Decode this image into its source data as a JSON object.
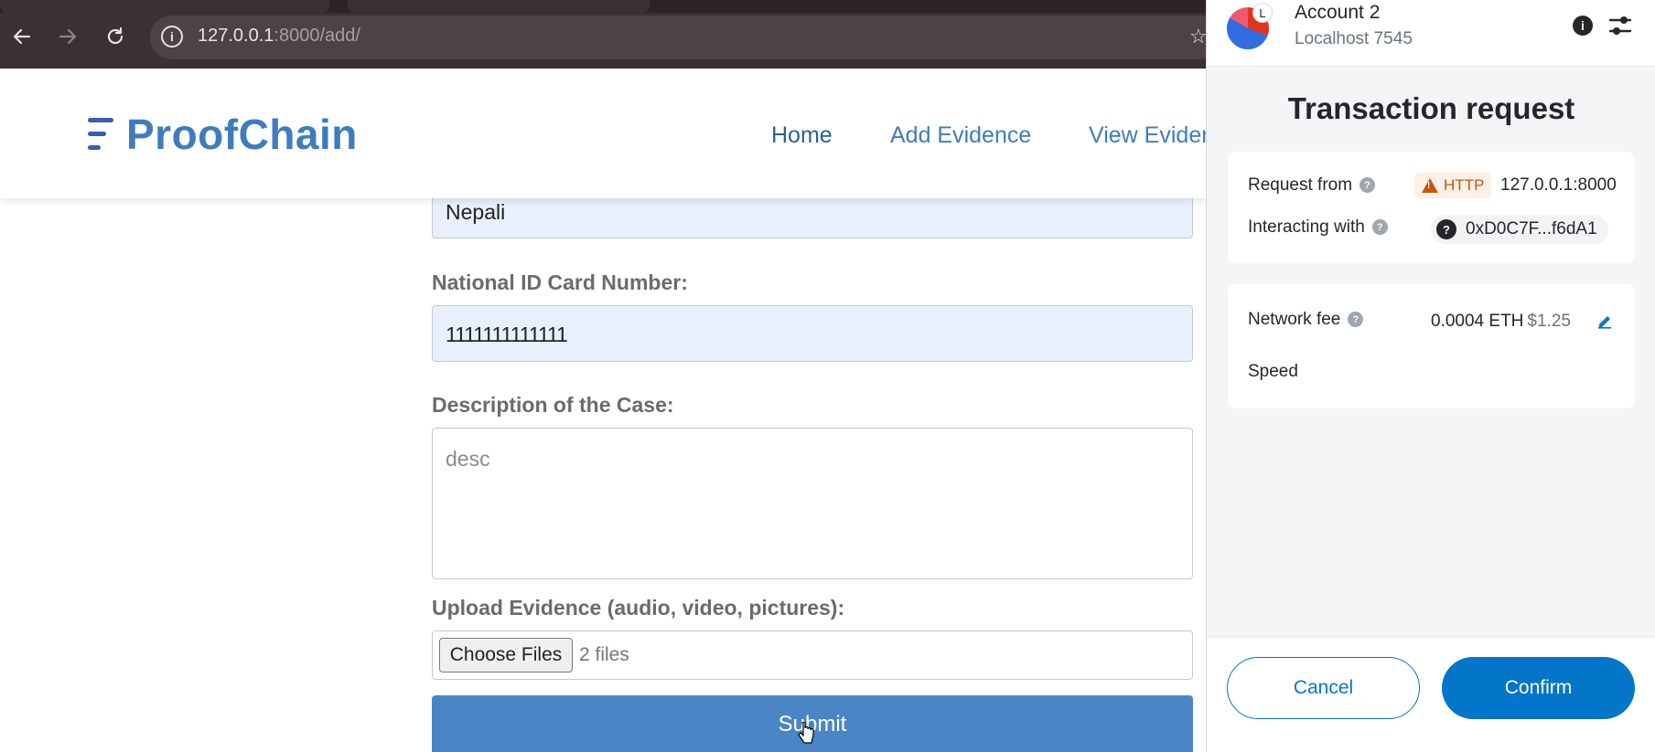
{
  "browser": {
    "url_host": "127.0.0.1",
    "url_path": ":8000/add/"
  },
  "site": {
    "logo": "ProofChain",
    "nav": [
      "Home",
      "Add Evidence",
      "View Evider"
    ]
  },
  "form": {
    "nationality_value": "Nepali",
    "national_id_label": "National ID Card Number:",
    "national_id_value": "1111111111111",
    "description_label": "Description of the Case:",
    "description_placeholder": "desc",
    "upload_label": "Upload Evidence (audio, video, pictures):",
    "choose_files_label": "Choose Files",
    "files_selected": "2 files",
    "submit_label": "Submit"
  },
  "metamask": {
    "account_name": "Account 2",
    "network": "Localhost 7545",
    "avatar_badge": "L",
    "title": "Transaction request",
    "request_from_label": "Request from",
    "http_badge": "HTTP",
    "request_origin": "127.0.0.1:8000",
    "interacting_label": "Interacting with",
    "contract_address": "0xD0C7F...f6dA1",
    "network_fee_label": "Network fee",
    "fee_eth": "0.0004 ETH",
    "fee_usd": "$1.25",
    "speed_label": "Speed",
    "cancel_label": "Cancel",
    "confirm_label": "Confirm"
  },
  "colors": {
    "brand_blue": "#3f7cbf",
    "metamask_primary": "#0376c9",
    "warning_orange": "#c4580e"
  },
  "icons": [
    "back-arrow-icon",
    "forward-arrow-icon",
    "reload-icon",
    "site-info-icon",
    "bookmark-star-icon",
    "info-icon",
    "settings-sliders-icon",
    "help-icon",
    "warning-icon",
    "edit-pencil-icon",
    "mouse-cursor-icon"
  ]
}
